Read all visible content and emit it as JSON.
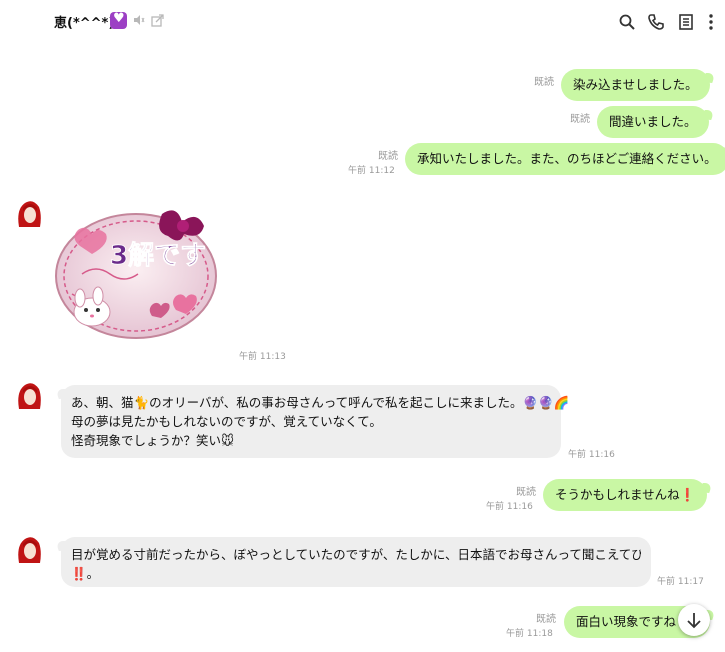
{
  "header": {
    "title": "恵(*^^*)",
    "icons": [
      "heart-badge",
      "mute-icon",
      "external-window-icon",
      "search-icon",
      "phone-icon",
      "notes-icon",
      "more-icon"
    ]
  },
  "messages": {
    "m1": {
      "text": "染み込ませしました。",
      "read": "既読"
    },
    "m2": {
      "text": "間違いました。",
      "read": "既読"
    },
    "m3": {
      "text": "承知いたしました。また、のちほどご連絡ください。",
      "read": "既読",
      "time": "午前 11:12"
    },
    "sticker": {
      "text": "3解です",
      "time": "午前 11:13"
    },
    "m5": {
      "line1": "あ、朝、猫🐈のオリーバが、私の事お母さんって呼んで私を起こしに来ました。🔮🔮🌈",
      "line2": "母の夢は見たかもしれないのですが、覚えていなくて。",
      "line3": "怪奇現象でしょうか？笑い🐭",
      "time": "午前 11:16"
    },
    "m6": {
      "text": "そうかもしれませんね❗",
      "read": "既読",
      "time": "午前 11:16"
    },
    "m7": {
      "line1": "目が覚める寸前だったから、ぼやっとしていたのですが、たしかに、日本語でお母さんって聞こえてびっくり",
      "line2": "‼️。",
      "time": "午前 11:17"
    },
    "m8": {
      "text": "面白い現象ですね",
      "read": "既読",
      "time": "午前 11:18"
    }
  },
  "colors": {
    "outgoing_bubble": "#c9f7a4",
    "incoming_bubble": "#eeeeee",
    "meta_text": "#9a9a9a",
    "badge": "#9c3fc4"
  }
}
